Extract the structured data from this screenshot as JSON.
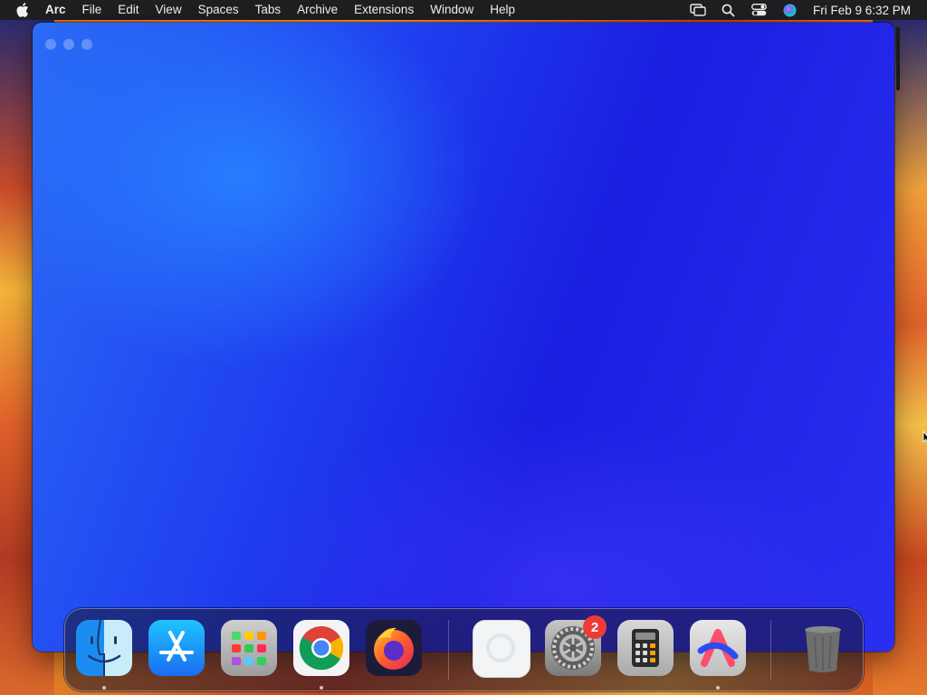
{
  "menubar": {
    "app_name": "Arc",
    "menus": [
      "File",
      "Edit",
      "View",
      "Spaces",
      "Tabs",
      "Archive",
      "Extensions",
      "Window",
      "Help"
    ],
    "clock": "Fri Feb 9  6:32 PM",
    "status_icons": [
      "screen-mirroring-icon",
      "spotlight-search-icon",
      "control-center-icon",
      "siri-icon"
    ]
  },
  "window": {
    "app": "Arc",
    "traffic_lights": [
      "close",
      "minimize",
      "zoom"
    ]
  },
  "dock": {
    "items": [
      {
        "name": "Finder",
        "icon": "finder-icon",
        "running": true
      },
      {
        "name": "App Store",
        "icon": "app-store-icon",
        "running": false
      },
      {
        "name": "Launchpad",
        "icon": "launchpad-icon",
        "running": false
      },
      {
        "name": "Google Chrome",
        "icon": "chrome-icon",
        "running": true
      },
      {
        "name": "Firefox",
        "icon": "firefox-icon",
        "running": false
      },
      {
        "name": "Preview",
        "icon": "preview-icon",
        "running": false
      },
      {
        "name": "System Settings",
        "icon": "system-settings-icon",
        "running": false,
        "badge": "2"
      },
      {
        "name": "Calculator",
        "icon": "calculator-icon",
        "running": false
      },
      {
        "name": "Arc",
        "icon": "arc-icon",
        "running": true
      },
      {
        "name": "Trash",
        "icon": "trash-icon",
        "running": false
      }
    ]
  },
  "colors": {
    "window_blue": "#1f3ff0",
    "badge_red": "#ee3b35",
    "menubar_bg": "#1f1f22"
  }
}
